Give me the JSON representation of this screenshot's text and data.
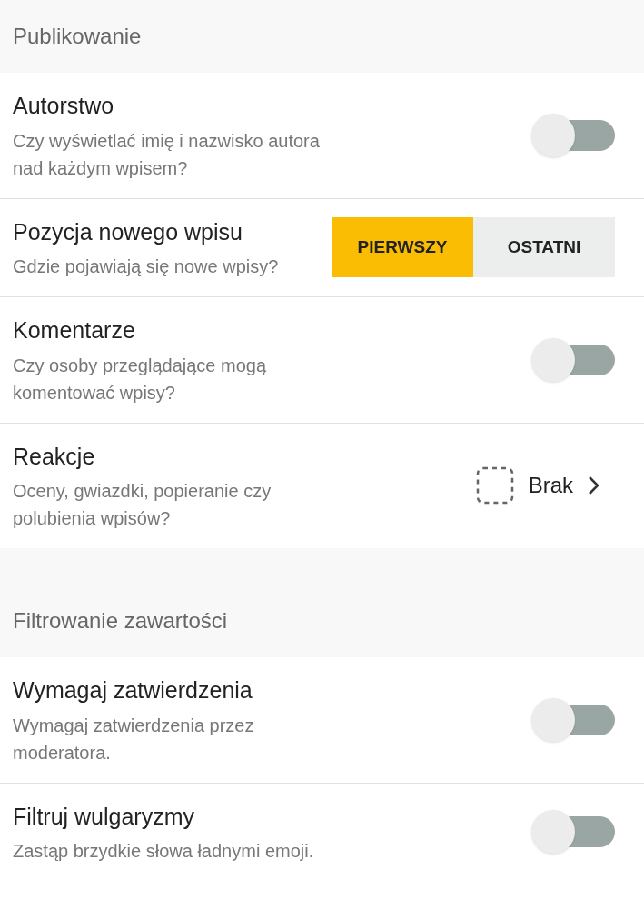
{
  "sections": [
    {
      "title": "Publikowanie",
      "items": [
        {
          "kind": "toggle",
          "title": "Autorstwo",
          "description": "Czy wyświetlać imię i nazwisko autora nad każdym wpisem?",
          "on": false
        },
        {
          "kind": "segmented",
          "title": "Pozycja nowego wpisu",
          "description": "Gdzie pojawiają się nowe wpisy?",
          "options": [
            {
              "label": "PIERWSZY",
              "selected": true
            },
            {
              "label": "OSTATNI",
              "selected": false
            }
          ]
        },
        {
          "kind": "toggle",
          "title": "Komentarze",
          "description": "Czy osoby przeglądające mogą komentować wpisy?",
          "on": false
        },
        {
          "kind": "link",
          "title": "Reakcje",
          "description": "Oceny, gwiazdki, popieranie czy polubienia wpisów?",
          "value": "Brak"
        }
      ]
    },
    {
      "title": "Filtrowanie zawartości",
      "items": [
        {
          "kind": "toggle",
          "title": "Wymagaj zatwierdzenia",
          "description": "Wymagaj zatwierdzenia przez moderatora.",
          "on": false
        },
        {
          "kind": "toggle",
          "title": "Filtruj wulgaryzmy",
          "description": "Zastąp brzydkie słowa ładnymi emoji.",
          "on": false
        }
      ]
    }
  ]
}
